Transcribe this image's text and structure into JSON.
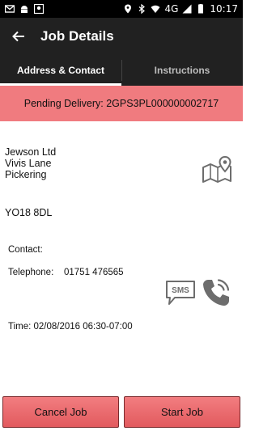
{
  "status_bar": {
    "network": "4G",
    "time": "10:17"
  },
  "header": {
    "title": "Job Details"
  },
  "tabs": [
    {
      "label": "Address & Contact",
      "active": true
    },
    {
      "label": "Instructions",
      "active": false
    }
  ],
  "banner": {
    "text": "Pending Delivery: 2GPS3PL000000002717",
    "color": "#f07b7f"
  },
  "address": {
    "line1": "Jewson Ltd",
    "line2": "Vivis Lane",
    "line3": "Pickering",
    "postcode": "YO18 8DL"
  },
  "contact": {
    "contact_label": "Contact:",
    "telephone_label": "Telephone:",
    "telephone_value": "01751 476565",
    "time_text": "Time: 02/08/2016 06:30-07:00"
  },
  "icons": {
    "map": "map-pin-icon",
    "sms": "sms-icon",
    "phone": "phone-icon",
    "sms_label": "SMS"
  },
  "actions": {
    "cancel_label": "Cancel Job",
    "start_label": "Start Job",
    "button_color": "#e8676b"
  }
}
